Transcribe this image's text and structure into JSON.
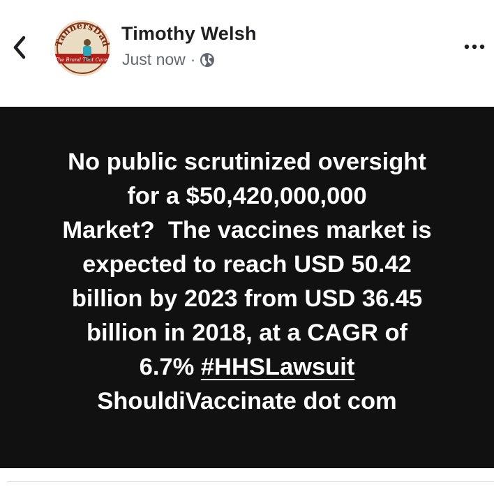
{
  "header": {
    "author_name": "Timothy Welsh",
    "timestamp": "Just now",
    "separator": "·",
    "privacy_icon": "globe-icon",
    "avatar_text_top": "TannersDad",
    "avatar_text_bottom": "The Brand That Cares",
    "back_icon": "chevron-left-icon",
    "more_icon": "more-options-icon"
  },
  "post": {
    "background": "#111111",
    "text_color": "#ffffff",
    "lines": [
      "No public scrutinized oversight",
      "for a $50,420,000,000",
      "Market?  The vaccines market is",
      "expected to reach USD 50.42",
      "billion by 2023 from USD 36.45",
      "billion in 2018, at a CAGR of"
    ],
    "line7_prefix": "6.7% ",
    "hashtag": "#HHSLawsuit",
    "line8": "ShouldiVaccinate dot com"
  },
  "colors": {
    "name": "#1c1e21",
    "meta": "#606770",
    "divider": "#d4d6da"
  }
}
